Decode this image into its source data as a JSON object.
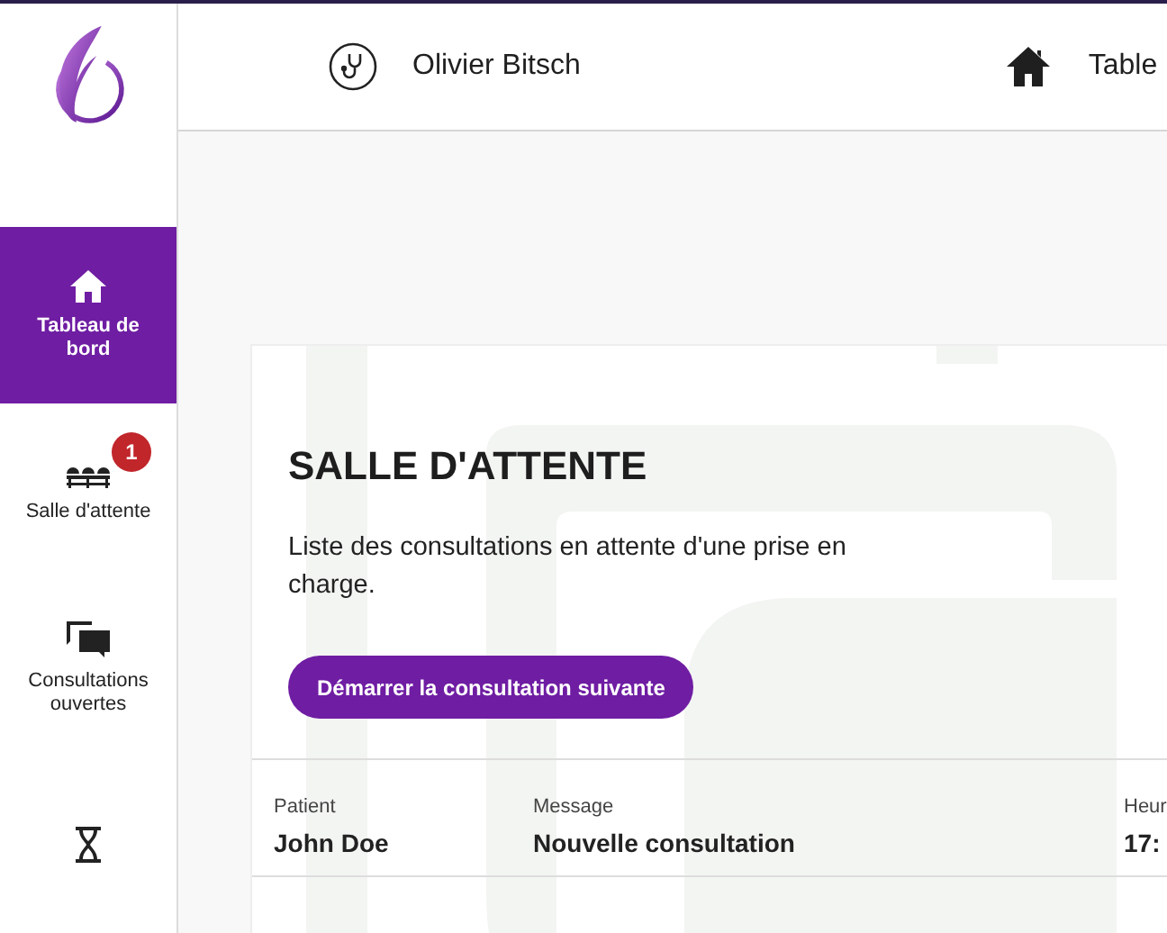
{
  "header": {
    "user_name": "Olivier Bitsch",
    "nav_label": "Table"
  },
  "sidebar": {
    "items": [
      {
        "label": "Tableau de bord",
        "selected": true
      },
      {
        "label": "Salle d'attente",
        "selected": false,
        "badge": "1"
      },
      {
        "label": "Consultations ouvertes",
        "selected": false
      },
      {
        "selected": false
      }
    ]
  },
  "card": {
    "title": "SALLE D'ATTENTE",
    "description": "Liste des consultations en attente d'une prise en charge.",
    "button": "Démarrer la consultation suivante",
    "table": {
      "columns": [
        "Patient",
        "Message",
        "Heur"
      ],
      "rows": [
        [
          "John Doe",
          "Nouvelle consultation",
          "17:"
        ]
      ]
    }
  }
}
